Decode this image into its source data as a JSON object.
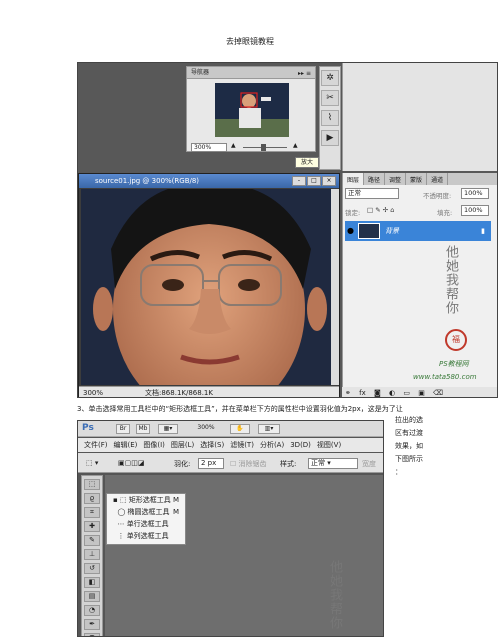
{
  "doc_title": "去掉眼镜教程",
  "navigator": {
    "title": "导航器",
    "zoom_value": "300%",
    "tooltip": "放大"
  },
  "document": {
    "title": "source01.jpg @ 300%(RGB/8)",
    "zoom": "300%",
    "file_info": "文档:868.1K/868.1K",
    "window_controls": [
      "-",
      "□",
      "×"
    ]
  },
  "layers_panel": {
    "tabs": [
      "图层",
      "路径",
      "调整",
      "蒙版",
      "通道"
    ],
    "blend_mode": "正常",
    "opacity_label": "不透明度:",
    "opacity_value": "100%",
    "lock_label": "锁定:",
    "fill_label": "填充:",
    "fill_value": "100%",
    "layer_name": "背景",
    "footer_link": "fx"
  },
  "watermark": {
    "text1": "他她我帮你",
    "seal": "福",
    "site_label": "PS教程网",
    "site": "www.tata580.com"
  },
  "caption": "3、单击选择常用工具栏中的“矩形选框工具”，并在菜单栏下方的属性栏中设置羽化值为2px，这是为了让",
  "side_text": [
    "拉出的选",
    "区有过渡",
    "效果，如",
    "下图所示",
    "："
  ],
  "screenshot2": {
    "logo": "Ps",
    "zoom": "300%",
    "menu": [
      "文件(F)",
      "编辑(E)",
      "图像(I)",
      "图层(L)",
      "选择(S)",
      "滤镜(T)",
      "分析(A)",
      "3D(D)",
      "视图(V)"
    ],
    "feather_label": "羽化:",
    "feather_value": "2 px",
    "antialias_label": "消除锯齿",
    "style_label": "样式:",
    "style_value": "正常",
    "width_label": "宽度",
    "flyout": [
      {
        "label": "矩形选框工具",
        "key": "M"
      },
      {
        "label": "椭圆选框工具",
        "key": "M"
      },
      {
        "label": "单行选框工具",
        "key": ""
      },
      {
        "label": "单列选框工具",
        "key": ""
      }
    ]
  }
}
